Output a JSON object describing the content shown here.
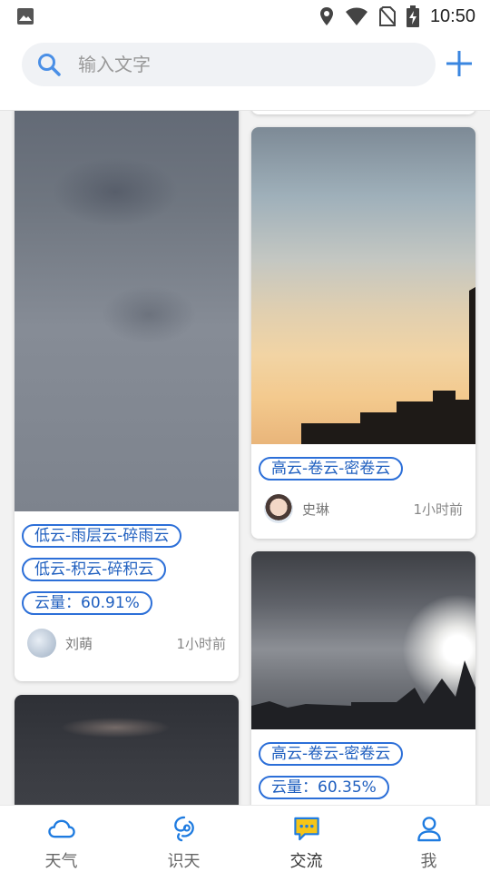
{
  "status_bar": {
    "time": "10:50"
  },
  "search": {
    "placeholder": "输入文字"
  },
  "feed": {
    "cards": [
      {
        "tags": [
          "低云-雨层云-碎雨云",
          "低云-积云-碎积云",
          "云量：60.91%"
        ],
        "author": "刘萌",
        "time_ago": "1小时前"
      },
      {
        "tags": [
          "高云-卷云-密卷云"
        ],
        "author": "史琳",
        "time_ago": "1小时前"
      },
      {
        "tags": [
          "高云-卷云-密卷云",
          "云量：60.35%"
        ]
      }
    ]
  },
  "nav": {
    "items": [
      {
        "label": "天气",
        "icon": "cloud-icon"
      },
      {
        "label": "识天",
        "icon": "recognize-icon"
      },
      {
        "label": "交流",
        "icon": "chat-icon",
        "active": true
      },
      {
        "label": "我",
        "icon": "user-icon"
      }
    ]
  },
  "colors": {
    "accent": "#2c6fd8",
    "tag_text": "#1f5fbf"
  }
}
